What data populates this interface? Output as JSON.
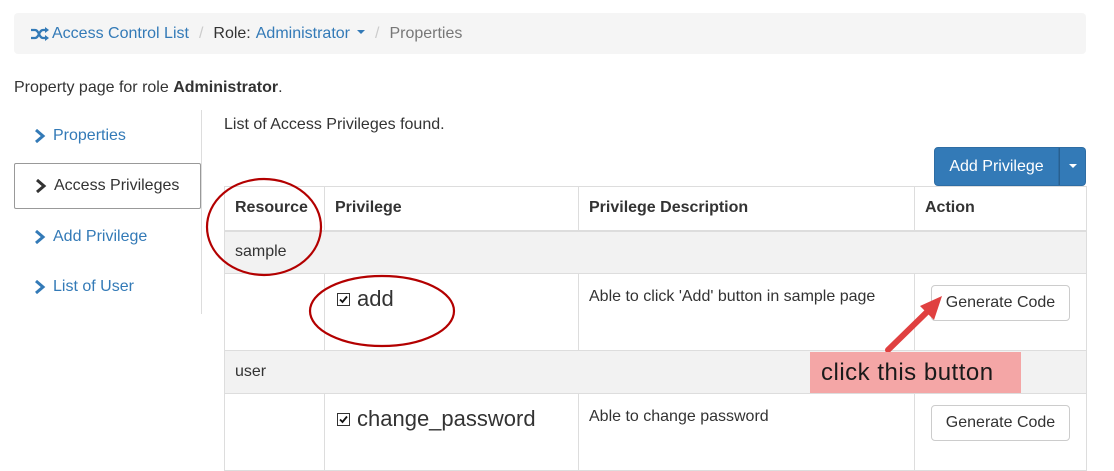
{
  "breadcrumb": {
    "home_label": "Access Control List",
    "role_prefix": "Role:",
    "role_value": "Administrator",
    "current": "Properties"
  },
  "intro": {
    "prefix": "Property page for role ",
    "role": "Administrator",
    "suffix": "."
  },
  "sidebar": {
    "items": [
      {
        "label": "Properties",
        "active": false
      },
      {
        "label": "Access Privileges",
        "active": true
      },
      {
        "label": "Add Privilege",
        "active": false
      },
      {
        "label": "List of User",
        "active": false
      }
    ]
  },
  "main": {
    "heading": "List of Access Privileges found.",
    "add_button": "Add Privilege",
    "table": {
      "headers": [
        "Resource",
        "Privilege",
        "Privilege Description",
        "Action"
      ],
      "groups": [
        {
          "resource": "sample",
          "rows": [
            {
              "privilege": "add",
              "checked": true,
              "description": "Able to click 'Add' button in sample page",
              "action": "Generate Code"
            }
          ]
        },
        {
          "resource": "user",
          "rows": [
            {
              "privilege": "change_password",
              "checked": true,
              "description": "Able to change password",
              "action": "Generate Code"
            }
          ]
        }
      ]
    }
  },
  "annotation": {
    "callout_text": "click this button",
    "mark_color": "#c00000",
    "callout_bg": "#f4a6a6"
  },
  "colors": {
    "link": "#337ab7",
    "primary": "#337ab7",
    "breadcrumb_bg": "#f5f5f5"
  }
}
